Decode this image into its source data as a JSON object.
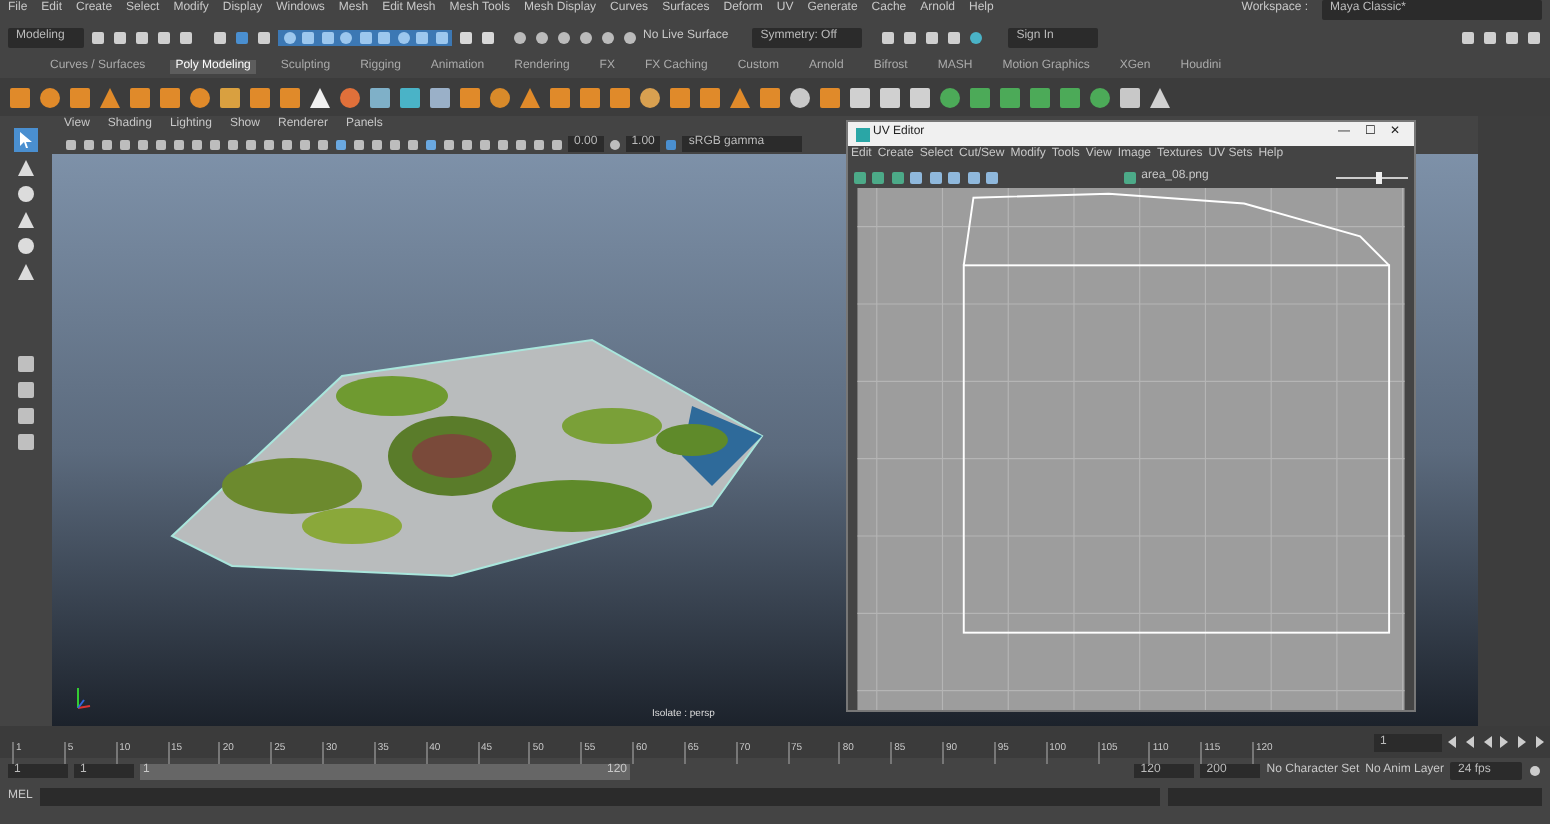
{
  "menu_bar": {
    "items": [
      "File",
      "Edit",
      "Create",
      "Select",
      "Modify",
      "Display",
      "Windows",
      "Mesh",
      "Edit Mesh",
      "Mesh Tools",
      "Mesh Display",
      "Curves",
      "Surfaces",
      "Deform",
      "UV",
      "Generate",
      "Cache",
      "Arnold",
      "Help"
    ]
  },
  "workspace": {
    "label": "Workspace :",
    "value": "Maya Classic*"
  },
  "status_line": {
    "mode": "Modeling",
    "live_surface": "No Live Surface",
    "symmetry": "Symmetry: Off",
    "sign_in": "Sign In"
  },
  "shelf": {
    "tabs": [
      {
        "label": "Curves / Surfaces",
        "selected": false
      },
      {
        "label": "Poly Modeling",
        "selected": true
      },
      {
        "label": "Sculpting",
        "selected": false
      },
      {
        "label": "Rigging",
        "selected": false
      },
      {
        "label": "Animation",
        "selected": false
      },
      {
        "label": "Rendering",
        "selected": false
      },
      {
        "label": "FX",
        "selected": false
      },
      {
        "label": "FX Caching",
        "selected": false
      },
      {
        "label": "Custom",
        "selected": false
      },
      {
        "label": "Arnold",
        "selected": false
      },
      {
        "label": "Bifrost",
        "selected": false
      },
      {
        "label": "MASH",
        "selected": false
      },
      {
        "label": "Motion Graphics",
        "selected": false
      },
      {
        "label": "XGen",
        "selected": false
      },
      {
        "label": "Houdini",
        "selected": false
      }
    ]
  },
  "viewport": {
    "menu": [
      "View",
      "Shading",
      "Lighting",
      "Show",
      "Renderer",
      "Panels"
    ],
    "exposure": "0.00",
    "gamma": "1.00",
    "color_space": "sRGB gamma",
    "camera_label": "Isolate : persp"
  },
  "uv_editor": {
    "title": "UV Editor",
    "controls": [
      "—",
      "☐",
      "✕"
    ],
    "menu": [
      "Edit",
      "Create",
      "Select",
      "Cut/Sew",
      "Modify",
      "Tools",
      "View",
      "Image",
      "Textures",
      "UV Sets",
      "Help"
    ],
    "texture": "area_08.png"
  },
  "timeline": {
    "ticks": [
      "1",
      "5",
      "10",
      "15",
      "20",
      "25",
      "30",
      "35",
      "40",
      "45",
      "50",
      "55",
      "60",
      "65",
      "70",
      "75",
      "80",
      "85",
      "90",
      "95",
      "100",
      "105",
      "110",
      "115",
      "120"
    ],
    "current_frame": "1"
  },
  "range": {
    "start": "1",
    "playback_start": "1",
    "slider_start": "1",
    "slider_end": "120",
    "playback_end": "120",
    "end": "200",
    "character_set": "No Character Set",
    "anim_layer": "No Anim Layer",
    "fps": "24 fps"
  },
  "command_line": {
    "language": "MEL"
  }
}
